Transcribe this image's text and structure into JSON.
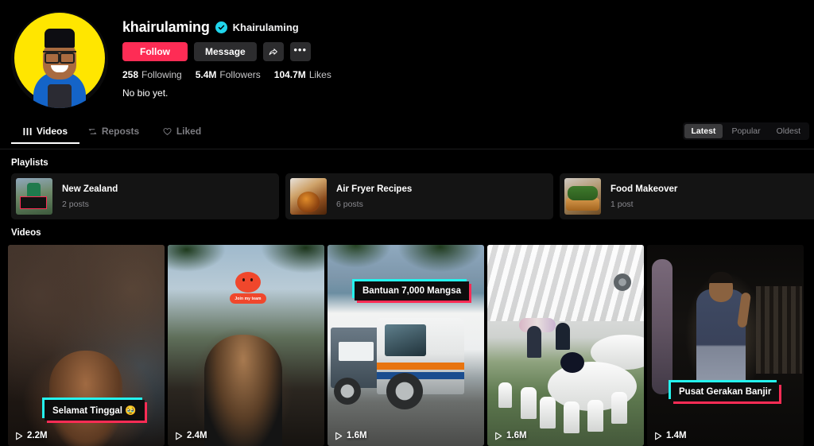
{
  "profile": {
    "username": "khairulaming",
    "nickname": "Khairulaming",
    "verified_icon": "verified-badge-icon",
    "avatar_bg_color": "#FFE600",
    "follow_label": "Follow",
    "message_label": "Message",
    "share_icon": "share-arrow-icon",
    "more_icon": "more-options-icon",
    "stats": [
      {
        "num": "258",
        "label": "Following"
      },
      {
        "num": "5.4M",
        "label": "Followers"
      },
      {
        "num": "104.7M",
        "label": "Likes"
      }
    ],
    "bio": "No bio yet."
  },
  "tabs": [
    {
      "label": "Videos",
      "icon": "grid-icon",
      "active": true
    },
    {
      "label": "Reposts",
      "icon": "repost-icon",
      "active": false
    },
    {
      "label": "Liked",
      "icon": "heart-lock-icon",
      "active": false
    }
  ],
  "sort": {
    "options": [
      {
        "label": "Latest",
        "active": true
      },
      {
        "label": "Popular",
        "active": false
      },
      {
        "label": "Oldest",
        "active": false
      }
    ]
  },
  "playlists_section": {
    "label": "Playlists",
    "items": [
      {
        "title": "New Zealand",
        "count": "2 posts"
      },
      {
        "title": "Air Fryer Recipes",
        "count": "6 posts"
      },
      {
        "title": "Food Makeover",
        "count": "1 post"
      }
    ]
  },
  "videos_section": {
    "label": "Videos",
    "items": [
      {
        "caption": "Selamat Tinggal 🥹",
        "views": "2.2M"
      },
      {
        "caption": "",
        "views": "2.4M",
        "sticker_text": "Join my team"
      },
      {
        "caption": "Bantuan 7,000 Mangsa",
        "views": "1.6M"
      },
      {
        "caption": "",
        "views": "1.6M"
      },
      {
        "caption": "Pusat Gerakan Banjir",
        "views": "1.4M"
      }
    ]
  },
  "colors": {
    "brand_red": "#FE2C55",
    "brand_cyan": "#25F4EE",
    "verified_blue": "#20D5EC",
    "background": "#000000"
  }
}
